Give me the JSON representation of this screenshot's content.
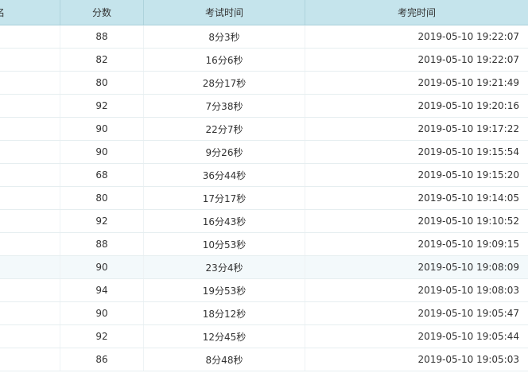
{
  "table": {
    "columns": {
      "name": "名",
      "score": "分数",
      "duration": "考试时间",
      "finished": "考完时间"
    },
    "rows": [
      {
        "score": "88",
        "duration": "8分3秒",
        "finished": "2019-05-10 19:22:07"
      },
      {
        "score": "82",
        "duration": "16分6秒",
        "finished": "2019-05-10 19:22:07"
      },
      {
        "score": "80",
        "duration": "28分17秒",
        "finished": "2019-05-10 19:21:49"
      },
      {
        "score": "92",
        "duration": "7分38秒",
        "finished": "2019-05-10 19:20:16"
      },
      {
        "score": "90",
        "duration": "22分7秒",
        "finished": "2019-05-10 19:17:22"
      },
      {
        "score": "90",
        "duration": "9分26秒",
        "finished": "2019-05-10 19:15:54"
      },
      {
        "score": "68",
        "duration": "36分44秒",
        "finished": "2019-05-10 19:15:20"
      },
      {
        "score": "80",
        "duration": "17分17秒",
        "finished": "2019-05-10 19:14:05"
      },
      {
        "score": "92",
        "duration": "16分43秒",
        "finished": "2019-05-10 19:10:52"
      },
      {
        "score": "88",
        "duration": "10分53秒",
        "finished": "2019-05-10 19:09:15"
      },
      {
        "score": "90",
        "duration": "23分4秒",
        "finished": "2019-05-10 19:08:09"
      },
      {
        "score": "94",
        "duration": "19分53秒",
        "finished": "2019-05-10 19:08:03"
      },
      {
        "score": "90",
        "duration": "18分12秒",
        "finished": "2019-05-10 19:05:47"
      },
      {
        "score": "92",
        "duration": "12分45秒",
        "finished": "2019-05-10 19:05:44"
      },
      {
        "score": "86",
        "duration": "8分48秒",
        "finished": "2019-05-10 19:05:03"
      }
    ]
  },
  "colors": {
    "header_bg": "#c5e4ec",
    "row_highlight": "#f3f9fb",
    "text": "#333333"
  }
}
